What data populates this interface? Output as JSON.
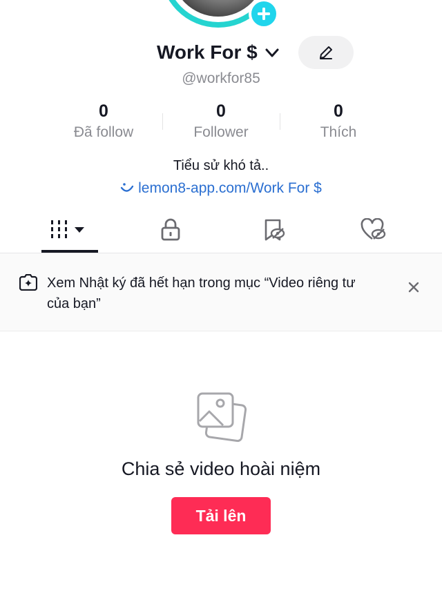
{
  "profile": {
    "display_name": "Work For $",
    "username": "@workfor85",
    "edit_icon": "pencil-icon",
    "add_badge_icon": "plus-icon"
  },
  "stats": [
    {
      "value": "0",
      "label": "Đã follow"
    },
    {
      "value": "0",
      "label": "Follower"
    },
    {
      "value": "0",
      "label": "Thích"
    }
  ],
  "bio": {
    "text": "Tiểu sử khó tả..",
    "link": "lemon8-app.com/Work For $",
    "link_icon": "smile-link-icon"
  },
  "tabs": [
    {
      "icon": "grid-icon",
      "active": true
    },
    {
      "icon": "lock-icon",
      "active": false
    },
    {
      "icon": "bookmark-hidden-icon",
      "active": false
    },
    {
      "icon": "heart-hidden-icon",
      "active": false
    }
  ],
  "notice": {
    "text": "Xem Nhật ký đã hết hạn trong mục “Video riêng tư của bạn”",
    "icon": "sparkle-camera-icon",
    "close_icon": "close-icon"
  },
  "empty_state": {
    "icon": "photos-icon",
    "title": "Chia sẻ video hoài niệm",
    "button_label": "Tải lên"
  },
  "colors": {
    "accent": "#fe2c55",
    "link": "#2b6fd1",
    "avatar_ring": "#25d4d0",
    "badge": "#20d5ec"
  }
}
